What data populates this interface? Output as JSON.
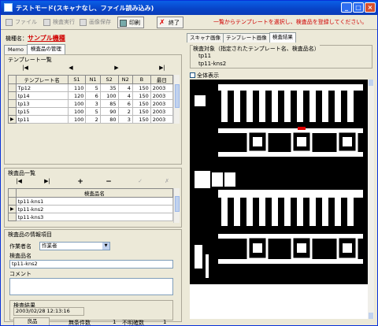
{
  "window": {
    "title": "テストモード(スキャナなし、ファイル読み込み)"
  },
  "toolbar": {
    "file": "ファイル",
    "run": "検査実行",
    "save_image": "画像保存",
    "print": "印刷",
    "exit": "終了",
    "notice": "一覧からテンプレートを選択し、検査品を登録してください。"
  },
  "model": {
    "label": "機種名：",
    "value": "サンプル機種"
  },
  "left_tabs": [
    "Memo",
    "検査品の管理"
  ],
  "template_list": {
    "title": "テンプレート一覧",
    "columns": [
      "テンプレート名",
      "S1",
      "N1",
      "S2",
      "N2",
      "B",
      "最日"
    ],
    "rows": [
      [
        "Tp12",
        "110",
        "5",
        "35",
        "4",
        "150",
        "2003"
      ],
      [
        "tp14",
        "120",
        "6",
        "100",
        "4",
        "150",
        "2003"
      ],
      [
        "tp13",
        "100",
        "3",
        "85",
        "6",
        "150",
        "2003"
      ],
      [
        "tp15",
        "100",
        "5",
        "90",
        "2",
        "150",
        "2003"
      ],
      [
        "tp11",
        "100",
        "2",
        "80",
        "3",
        "150",
        "2003"
      ]
    ],
    "current_index": 4
  },
  "inspection_list": {
    "title": "検査品一覧",
    "column": "検査品名",
    "rows": [
      "tp11-kns1",
      "tp11-kns2",
      "tp11-kns3"
    ],
    "current_index": 1
  },
  "info": {
    "title": "検査品の情報項目",
    "operator_label": "作業者名",
    "operator_value": "作業者",
    "name_label": "検査品名",
    "name_value": "tp11-kns2",
    "comment_label": "コメント",
    "result_title": "検査結果",
    "result_date": "2003/02/28 12:13:16",
    "result_status": "良品",
    "defect_count_label": "無条件数",
    "defect_count_value": "1",
    "unclear_count_label": "不明確数",
    "unclear_count_value": "1"
  },
  "right_tabs": [
    "スキャナ画像",
    "テンプレート画像",
    "検査結果"
  ],
  "target": {
    "label": "検査対象（指定されたテンプレート名、検査品名）",
    "template": "tp11",
    "inspection": "tp11-kns2"
  },
  "show_all_label": "全体表示",
  "colors": {
    "accent": "#d00000",
    "titlebar": "#0843c6",
    "selection": "#c1d2ee"
  }
}
